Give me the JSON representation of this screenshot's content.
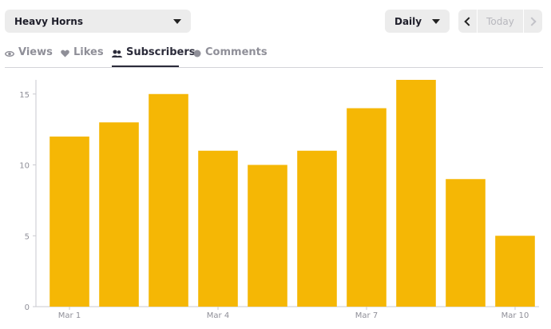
{
  "header": {
    "channel": "Heavy Horns",
    "period": "Daily",
    "today_label": "Today"
  },
  "tabs": [
    {
      "label": "Views",
      "icon": "eye-icon",
      "active": false
    },
    {
      "label": "Likes",
      "icon": "heart-icon",
      "active": false
    },
    {
      "label": "Subscribers",
      "icon": "users-icon",
      "active": true
    },
    {
      "label": "Comments",
      "icon": "comment-icon",
      "active": false
    }
  ],
  "colors": {
    "bar": "#f5b705",
    "text_dark": "#2b2b3a",
    "text_muted": "#8f8f98"
  },
  "chart_data": {
    "type": "bar",
    "categories": [
      "Mar 1",
      "Mar 2",
      "Mar 3",
      "Mar 4",
      "Mar 5",
      "Mar 6",
      "Mar 7",
      "Mar 8",
      "Mar 9",
      "Mar 10"
    ],
    "x_tick_labels": [
      "Mar 1",
      "Mar 4",
      "Mar 7",
      "Mar 10"
    ],
    "values": [
      12,
      13,
      15,
      11,
      10,
      11,
      14,
      16,
      9,
      5
    ],
    "y_ticks": [
      "0",
      "5",
      "10",
      "15"
    ],
    "ylim": [
      0,
      16
    ],
    "grid": false
  }
}
